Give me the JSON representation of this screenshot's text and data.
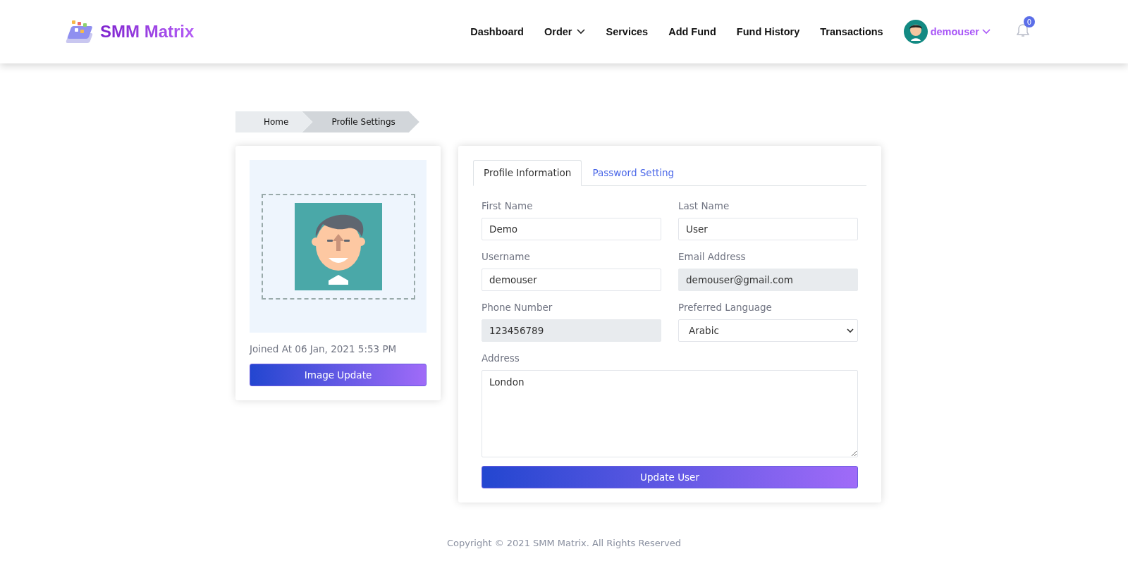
{
  "brand": {
    "name": "SMM Matrix"
  },
  "nav": [
    {
      "label": "Dashboard",
      "dropdown": false
    },
    {
      "label": "Order",
      "dropdown": true
    },
    {
      "label": "Services",
      "dropdown": false
    },
    {
      "label": "Add Fund",
      "dropdown": false
    },
    {
      "label": "Fund History",
      "dropdown": false
    },
    {
      "label": "Transactions",
      "dropdown": false
    }
  ],
  "user": {
    "name": "demouser",
    "notifications": "0"
  },
  "breadcrumb": [
    "Home",
    "Profile Settings"
  ],
  "profile_card": {
    "joined": "Joined At 06 Jan, 2021 5:53 PM",
    "button": "Image Update"
  },
  "tabs": [
    {
      "label": "Profile Information",
      "selected": true
    },
    {
      "label": "Password Setting",
      "selected": false
    }
  ],
  "fields": [
    {
      "label": "First Name",
      "value": "Demo",
      "kind": "text"
    },
    {
      "label": "Last Name",
      "value": "User",
      "kind": "text"
    },
    {
      "label": "Username",
      "value": "demouser",
      "kind": "text"
    },
    {
      "label": "Email Address",
      "value": "demouser@gmail.com",
      "kind": "locked"
    },
    {
      "label": "Phone Number",
      "value": "123456789",
      "kind": "locked"
    },
    {
      "label": "Preferred Language",
      "value": "Arabic",
      "kind": "select"
    },
    {
      "label": "Address",
      "value": "London",
      "kind": "textarea"
    }
  ],
  "submit": "Update User",
  "footer": "Copyright © 2021 SMM Matrix. All Rights Reserved"
}
